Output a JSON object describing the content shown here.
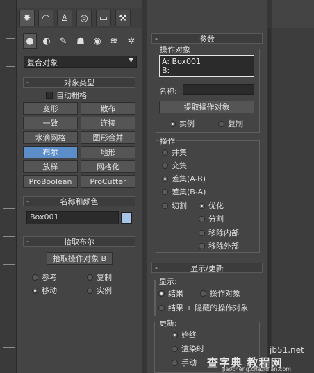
{
  "tabs": [
    "create",
    "modify",
    "hierarchy",
    "motion",
    "display",
    "utilities"
  ],
  "sub_icons": [
    "geometry",
    "shapes",
    "lights",
    "cameras",
    "helpers",
    "space-warps",
    "systems"
  ],
  "category_select": {
    "value": "复合对象"
  },
  "object_type": {
    "title": "对象类型",
    "autogrid_label": "自动栅格",
    "buttons": [
      "变形",
      "散布",
      "一致",
      "连接",
      "水滴网格",
      "图形合并",
      "布尔",
      "地形",
      "放样",
      "网格化",
      "ProBoolean",
      "ProCutter"
    ],
    "active_button": "布尔"
  },
  "name_color": {
    "title": "名称和颜色",
    "name_value": "Box001",
    "swatch_color": "#a7c4e8"
  },
  "pick_boolean": {
    "title": "拾取布尔",
    "pick_button": "拾取操作对象 B",
    "options": [
      "参考",
      "复制",
      "移动",
      "实例"
    ],
    "selected": "移动"
  },
  "parameters": {
    "title": "参数",
    "operands_group": "操作对象",
    "operand_a": "A: Box001",
    "operand_b": "B:",
    "name_label": "名称:",
    "name_value": "",
    "extract_button": "提取操作对象",
    "extract_options": [
      "实例",
      "复制"
    ],
    "extract_selected": "实例",
    "operation_group": "操作",
    "operations": [
      "并集",
      "交集",
      "差集(A-B)",
      "差集(B-A)"
    ],
    "operation_selected": "差集(A-B)",
    "cut_label": "切割",
    "cut_options": [
      "优化",
      "分割",
      "移除内部",
      "移除外部"
    ],
    "cut_selected": "优化"
  },
  "display_update": {
    "title": "显示/更新",
    "display_group": "显示:",
    "display_options": [
      "结果",
      "操作对象",
      "结果 + 隐藏的操作对象"
    ],
    "display_selected": "结果",
    "update_group": "更新:",
    "update_options": [
      "始终",
      "渲染时",
      "手动"
    ],
    "update_selected": "始终"
  },
  "watermark": {
    "site": "jb51.net",
    "text": "查字典 教程网",
    "url": "jiaocheng.chazidian.com"
  }
}
